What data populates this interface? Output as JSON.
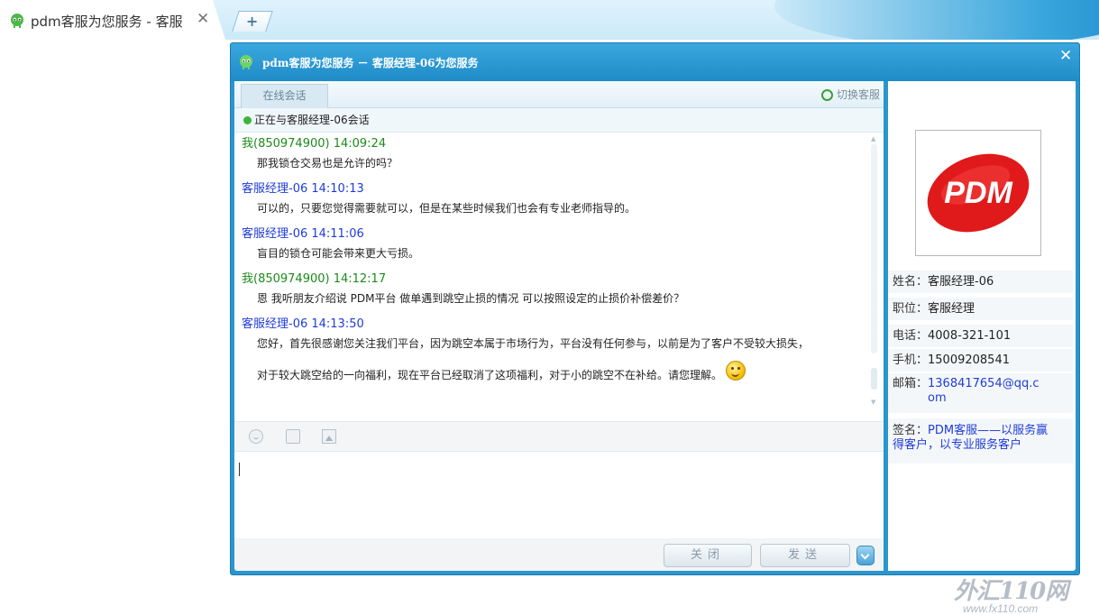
{
  "browser": {
    "tab_title": "pdm客服为您服务 - 客服",
    "tab_close": "✕",
    "new_tab": "+"
  },
  "window": {
    "title": "pdm客服为您服务 － 客服经理-06为您服务",
    "close": "✕"
  },
  "chat": {
    "tab_label": "在线会话",
    "switch_label": "切换客服",
    "status_text": "正在与客服经理-06会话",
    "messages": [
      {
        "sender": "我(850974900) 14:09:24",
        "role": "me",
        "text": "那我锁仓交易也是允许的吗？"
      },
      {
        "sender": "客服经理-06 14:10:13",
        "role": "agent",
        "text": "可以的，只要您觉得需要就可以，但是在某些时候我们也会有专业老师指导的。"
      },
      {
        "sender": "客服经理-06 14:11:06",
        "role": "agent",
        "text": "盲目的锁仓可能会带来更大亏损。"
      },
      {
        "sender": "我(850974900) 14:12:17",
        "role": "me",
        "text": "恩  我听朋友介绍说 PDM平台  做单遇到跳空止损的情况 可以按照设定的止损价补偿差价？"
      },
      {
        "sender": "客服经理-06 14:13:50",
        "role": "agent",
        "text": "您好，首先很感谢您关注我们平台，因为跳空本属于市场行为，平台没有任何参与，以前是为了客户不受较大损失，",
        "text2": "对于较大跳空给的一向福利，现在平台已经取消了这项福利，对于小的跳空不在补给。请您理解。"
      }
    ],
    "input_value": "",
    "close_button": "关闭",
    "send_button": "发送"
  },
  "agent": {
    "logo_text": "PDM",
    "name_label": "姓名：",
    "name": "客服经理-06",
    "position_label": "职位：",
    "position": "客服经理",
    "phone_label": "电话：",
    "phone": "4008-321-101",
    "mobile_label": "手机：",
    "mobile": "15009208541",
    "email_label": "邮箱：",
    "email_line1": "1368417654@qq.c",
    "email_line2": "om",
    "sig_label": "签名：",
    "sig_line1": "PDM客服——以服务赢",
    "sig_line2": "得客户，以专业服务客户"
  },
  "watermark": {
    "brand": "外汇110网",
    "url": "www.fx110.com"
  },
  "colors": {
    "accent": "#2a96cf",
    "me": "#1b8a1b",
    "agent": "#1f3cd8",
    "logo_red": "#e01a1a"
  }
}
